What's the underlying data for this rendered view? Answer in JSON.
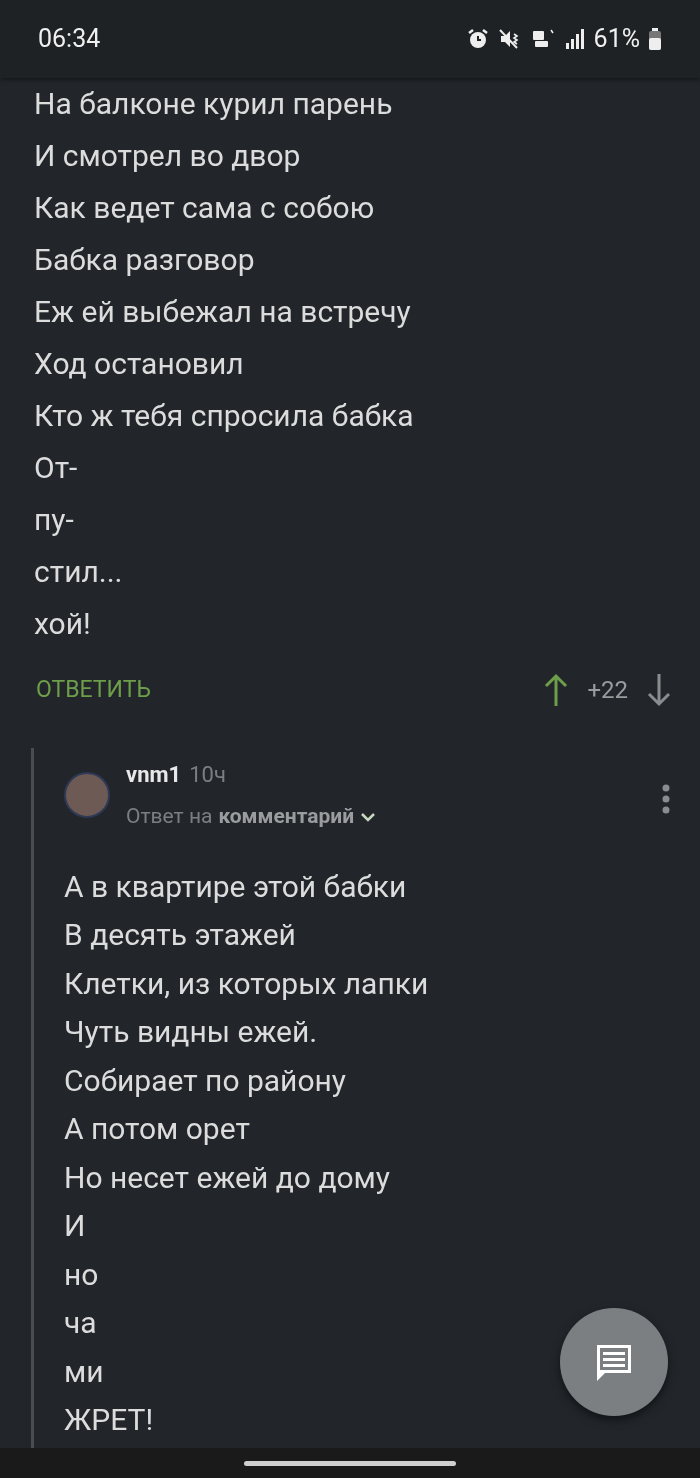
{
  "status_bar": {
    "time": "06:34",
    "battery": "61%"
  },
  "comment": {
    "lines": [
      "На балконе курил парень",
      "И смотрел во двор",
      "Как ведет сама с собою",
      "Бабка разговор",
      "Еж ей выбежал на встречу",
      "Ход остановил",
      "Кто ж тебя спросила бабка",
      "От-",
      "пу-",
      "стил...",
      "хой!"
    ],
    "reply_label": "ОТВЕТИТЬ",
    "score": "+22",
    "upvote": {
      "selected": true
    },
    "downvote": {
      "selected": false
    }
  },
  "reply": {
    "author": "vnm1",
    "time": "10ч",
    "reply_to_prefix": "Ответ на",
    "reply_to_link": "комментарий",
    "lines": [
      "А в квартире этой бабки",
      "В десять этажей",
      "Клетки, из которых лапки",
      "Чуть видны ежей.",
      "Собирает по району",
      "А потом орет",
      "Но несет ежей до дому",
      "И",
      "но",
      "ча",
      "ми",
      "ЖРЕТ!"
    ]
  }
}
